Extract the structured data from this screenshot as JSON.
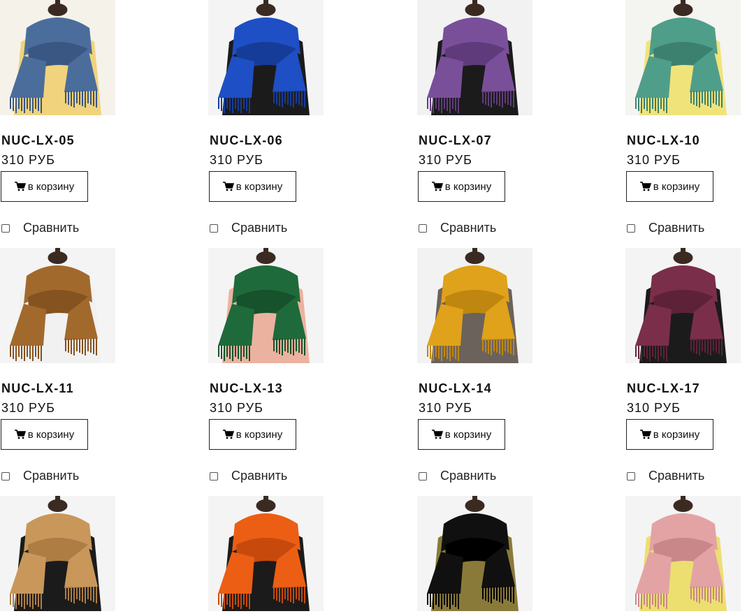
{
  "catalog": {
    "cart_label": "в корзину",
    "compare_label": "Сравнить",
    "products": [
      {
        "name": "NUC-LX-05",
        "price": "310 РУБ",
        "scarf": "#4a6d9c",
        "shade": "#3a5784",
        "bg": "#f5f2ea",
        "cloth": "#f0d37c"
      },
      {
        "name": "NUC-LX-06",
        "price": "310 РУБ",
        "scarf": "#1e4fc4",
        "shade": "#163c9a",
        "bg": "#f4f4f4",
        "cloth": "#1b1b1b"
      },
      {
        "name": "NUC-LX-07",
        "price": "310 РУБ",
        "scarf": "#7a4f9a",
        "shade": "#5f3b7c",
        "bg": "#f2f2f2",
        "cloth": "#1b1b1b"
      },
      {
        "name": "NUC-LX-10",
        "price": "310 РУБ",
        "scarf": "#4f9e8a",
        "shade": "#3c8170",
        "bg": "#f4f4f0",
        "cloth": "#f0e37a"
      },
      {
        "name": "NUC-LX-11",
        "price": "310 РУБ",
        "scarf": "#a2692c",
        "shade": "#85531f",
        "bg": "#f4f4f4",
        "cloth": "#f1f1f1"
      },
      {
        "name": "NUC-LX-13",
        "price": "310 РУБ",
        "scarf": "#1f6a3a",
        "shade": "#16522b",
        "bg": "#f4f4f4",
        "cloth": "#ecb2a0"
      },
      {
        "name": "NUC-LX-14",
        "price": "310 РУБ",
        "scarf": "#e0a21a",
        "shade": "#c08710",
        "bg": "#f2f2f2",
        "cloth": "#6b625c"
      },
      {
        "name": "NUC-LX-17",
        "price": "310 РУБ",
        "scarf": "#7a2e4a",
        "shade": "#5e2238",
        "bg": "#f4f4f4",
        "cloth": "#1b1b1b"
      },
      {
        "name": "",
        "price": "",
        "scarf": "#c9975a",
        "shade": "#ad7d44",
        "bg": "#f4f4f4",
        "cloth": "#1b1b1b"
      },
      {
        "name": "",
        "price": "",
        "scarf": "#ec5e14",
        "shade": "#c74a0c",
        "bg": "#f4f4f4",
        "cloth": "#1b1b1b"
      },
      {
        "name": "",
        "price": "",
        "scarf": "#101010",
        "shade": "#000000",
        "bg": "#f4f4f4",
        "cloth": "#8a7a3a"
      },
      {
        "name": "",
        "price": "",
        "scarf": "#e3a3a5",
        "shade": "#c98789",
        "bg": "#f4f4f4",
        "cloth": "#ecdf70"
      }
    ]
  }
}
